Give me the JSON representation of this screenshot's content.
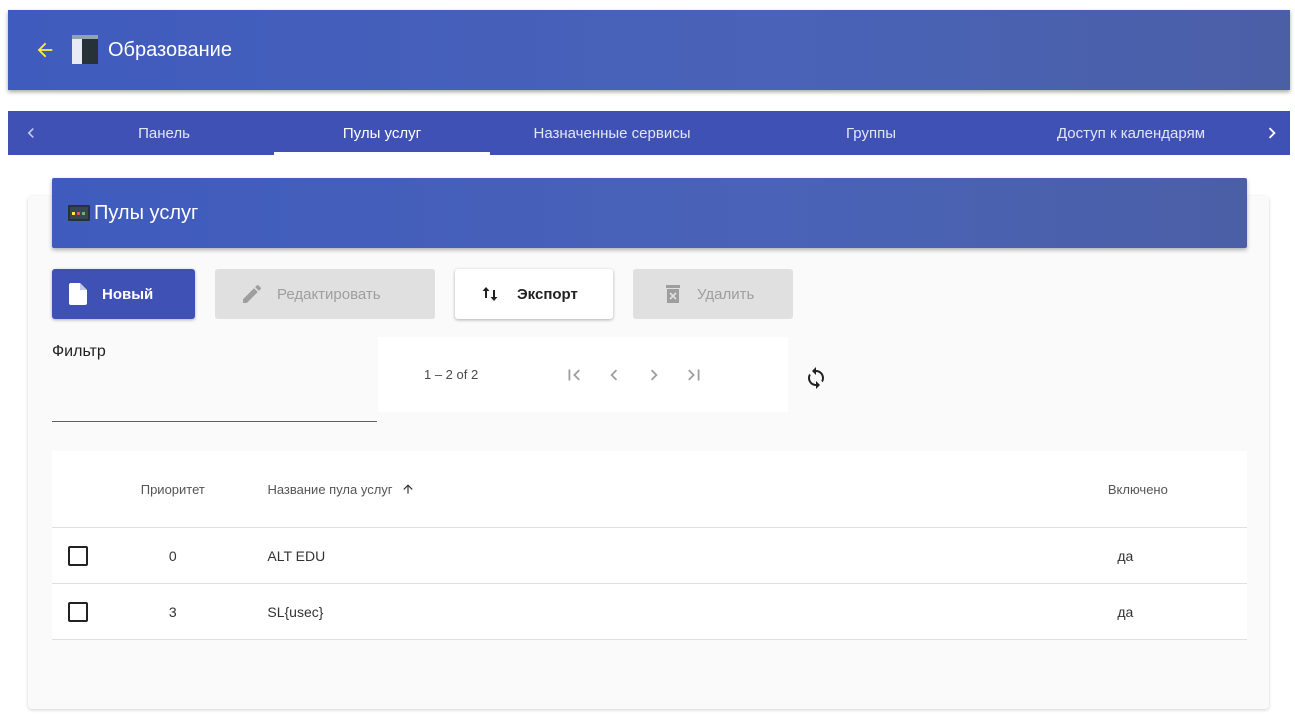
{
  "header": {
    "title": "Образование",
    "back_icon": "arrow-left-icon",
    "app_icon": "book-icon"
  },
  "tabs": {
    "items": [
      {
        "label": "Панель"
      },
      {
        "label": "Пулы услуг",
        "active": true
      },
      {
        "label": "Назначенные сервисы"
      },
      {
        "label": "Группы"
      },
      {
        "label": "Доступ к календарям"
      }
    ]
  },
  "card": {
    "title": "Пулы услуг",
    "icon": "pool-icon"
  },
  "toolbar": {
    "new_label": "Новый",
    "edit_label": "Редактировать",
    "export_label": "Экспорт",
    "delete_label": "Удалить"
  },
  "filter": {
    "label": "Фильтр",
    "value": ""
  },
  "paginator": {
    "range": "1 – 2 of 2"
  },
  "table": {
    "columns": {
      "priority": "Приоритет",
      "name": "Название пула услуг",
      "enabled": "Включено"
    },
    "rows": [
      {
        "priority": "0",
        "name": "ALT EDU",
        "enabled": "да"
      },
      {
        "priority": "3",
        "name": "SL{usec}",
        "enabled": "да"
      }
    ]
  },
  "colors": {
    "primary": "#3f51b5",
    "accent_yellow": "#ffeb3b",
    "disabled": "#e0e0e0"
  }
}
